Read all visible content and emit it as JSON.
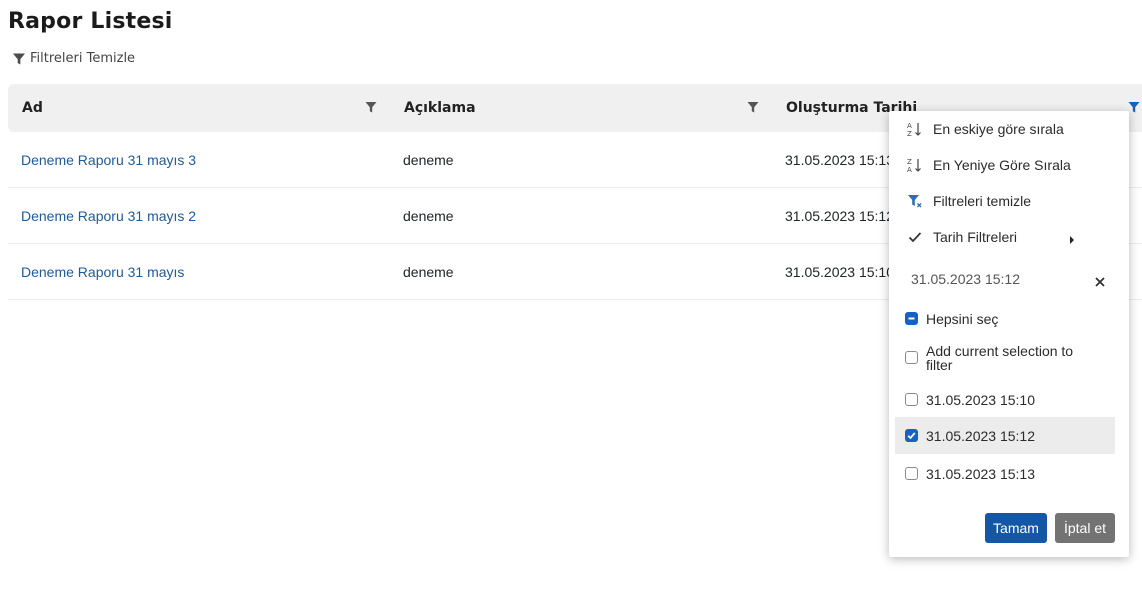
{
  "page": {
    "title": "Rapor Listesi",
    "clear_filters_label": "Filtreleri Temizle"
  },
  "grid": {
    "columns": [
      {
        "label": "Ad"
      },
      {
        "label": "Açıklama"
      },
      {
        "label": "Oluşturma Tarihi"
      }
    ],
    "rows": [
      {
        "name": "Deneme Raporu 31 mayıs 3",
        "description": "deneme",
        "created": "31.05.2023 15:13"
      },
      {
        "name": "Deneme Raporu 31 mayıs 2",
        "description": "deneme",
        "created": "31.05.2023 15:12"
      },
      {
        "name": "Deneme Raporu 31 mayıs",
        "description": "deneme",
        "created": "31.05.2023 15:10"
      }
    ]
  },
  "filter_menu": {
    "items": [
      {
        "label": "En eskiye göre sırala",
        "icon": "sort-ascending-icon"
      },
      {
        "label": "En Yeniye Göre Sırala",
        "icon": "sort-descending-icon"
      },
      {
        "label": "Filtreleri temizle",
        "icon": "clear-filter-icon"
      },
      {
        "label": "Tarih Filtreleri",
        "icon": "check-icon"
      }
    ],
    "date_value": "31.05.2023 15:12",
    "select_all_label": "Hepsini seç",
    "add_selection_label": "Add current selection to filter",
    "options": [
      {
        "label": "31.05.2023 15:10",
        "checked": false
      },
      {
        "label": "31.05.2023 15:12",
        "checked": true
      },
      {
        "label": "31.05.2023 15:13",
        "checked": false
      }
    ],
    "ok_label": "Tamam",
    "cancel_label": "İptal et"
  },
  "colors": {
    "link": "#1f5a9a",
    "primary": "#1357a6",
    "checkbox": "#1662c4",
    "header_bg": "#f0f0f0"
  }
}
